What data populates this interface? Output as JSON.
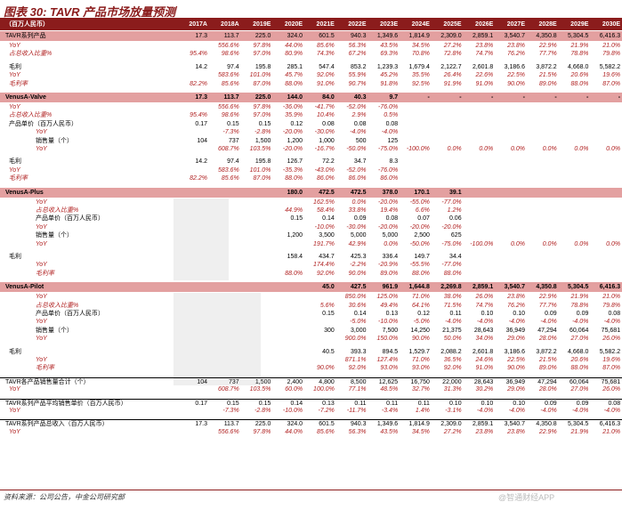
{
  "title": "图表 30: TAVR 产品市场放量预测",
  "years": [
    "2017A",
    "2018A",
    "2019E",
    "2020E",
    "2021E",
    "2022E",
    "2023E",
    "2024E",
    "2025E",
    "2026E",
    "2027E",
    "2028E",
    "2029E",
    "2030E"
  ],
  "header_label": "（百万人民币）",
  "rows": [
    {
      "label": "TAVR系列产品",
      "style": "sec",
      "v": [
        "17.3",
        "113.7",
        "225.0",
        "324.0",
        "601.5",
        "940.3",
        "1,349.6",
        "1,814.9",
        "2,309.0",
        "2,859.1",
        "3,540.7",
        "4,350.8",
        "5,304.5",
        "6,416.3"
      ]
    },
    {
      "label": "YoY",
      "style": "red i1",
      "v": [
        "",
        "556.6%",
        "97.8%",
        "44.0%",
        "85.6%",
        "56.3%",
        "43.5%",
        "34.5%",
        "27.2%",
        "23.8%",
        "23.8%",
        "22.9%",
        "21.9%",
        "21.0%"
      ]
    },
    {
      "label": "占总收入比重%",
      "style": "red i1",
      "v": [
        "95.4%",
        "98.6%",
        "97.0%",
        "80.9%",
        "74.3%",
        "67.2%",
        "69.3%",
        "70.8%",
        "72.8%",
        "74.7%",
        "76.2%",
        "77.7%",
        "78.8%",
        "79.8%"
      ]
    },
    {
      "label": "",
      "style": "gap",
      "v": []
    },
    {
      "label": "毛利",
      "style": "i1",
      "v": [
        "14.2",
        "97.4",
        "195.8",
        "285.1",
        "547.4",
        "853.2",
        "1,239.3",
        "1,679.4",
        "2,122.7",
        "2,601.8",
        "3,186.6",
        "3,872.2",
        "4,668.0",
        "5,582.2"
      ]
    },
    {
      "label": "YoY",
      "style": "red i1",
      "v": [
        "",
        "583.6%",
        "101.0%",
        "45.7%",
        "92.0%",
        "55.9%",
        "45.2%",
        "35.5%",
        "26.4%",
        "22.6%",
        "22.5%",
        "21.5%",
        "20.6%",
        "19.6%"
      ]
    },
    {
      "label": "毛利率",
      "style": "red i1",
      "v": [
        "82.2%",
        "85.6%",
        "87.0%",
        "88.0%",
        "91.0%",
        "90.7%",
        "91.8%",
        "92.5%",
        "91.9%",
        "91.0%",
        "90.0%",
        "89.0%",
        "88.0%",
        "87.0%"
      ]
    },
    {
      "label": "",
      "style": "gap",
      "v": []
    },
    {
      "label": "VenusA-Valve",
      "style": "sec bold",
      "v": [
        "17.3",
        "113.7",
        "225.0",
        "144.0",
        "84.0",
        "40.3",
        "9.7",
        "-",
        "-",
        "-",
        "-",
        "-",
        "-",
        "-"
      ]
    },
    {
      "label": "YoY",
      "style": "red i1",
      "v": [
        "",
        "556.6%",
        "97.8%",
        "-36.0%",
        "-41.7%",
        "-52.0%",
        "-76.0%",
        "",
        "",
        "",
        "",
        "",
        "",
        ""
      ]
    },
    {
      "label": "占总收入比重%",
      "style": "red i1",
      "v": [
        "95.4%",
        "98.6%",
        "97.0%",
        "35.9%",
        "10.4%",
        "2.9%",
        "0.5%",
        "",
        "",
        "",
        "",
        "",
        "",
        ""
      ]
    },
    {
      "label": "产品单价（百万人民币）",
      "style": "i1",
      "v": [
        "0.17",
        "0.15",
        "0.15",
        "0.12",
        "0.08",
        "0.08",
        "0.08",
        "",
        "",
        "",
        "",
        "",
        "",
        ""
      ]
    },
    {
      "label": "YoY",
      "style": "red i2",
      "v": [
        "",
        "-7.3%",
        "-2.8%",
        "-20.0%",
        "-30.0%",
        "-4.0%",
        "-4.0%",
        "",
        "",
        "",
        "",
        "",
        "",
        ""
      ]
    },
    {
      "label": "销售量（个）",
      "style": "i2",
      "v": [
        "104",
        "737",
        "1,500",
        "1,200",
        "1,000",
        "500",
        "125",
        "",
        "",
        "",
        "",
        "",
        "",
        ""
      ]
    },
    {
      "label": "YoY",
      "style": "red i2",
      "v": [
        "",
        "608.7%",
        "103.5%",
        "-20.0%",
        "-16.7%",
        "-50.0%",
        "-75.0%",
        "-100.0%",
        "0.0%",
        "0.0%",
        "0.0%",
        "0.0%",
        "0.0%",
        "0.0%"
      ]
    },
    {
      "label": "",
      "style": "gap",
      "v": []
    },
    {
      "label": "毛利",
      "style": "i1",
      "v": [
        "14.2",
        "97.4",
        "195.8",
        "126.7",
        "72.2",
        "34.7",
        "8.3",
        "",
        "",
        "",
        "",
        "",
        "",
        ""
      ]
    },
    {
      "label": "YoY",
      "style": "red i1",
      "v": [
        "",
        "583.6%",
        "101.0%",
        "-35.3%",
        "-43.0%",
        "-52.0%",
        "-76.0%",
        "",
        "",
        "",
        "",
        "",
        "",
        ""
      ]
    },
    {
      "label": "毛利率",
      "style": "red i1",
      "v": [
        "82.2%",
        "85.6%",
        "87.0%",
        "88.0%",
        "86.0%",
        "86.0%",
        "86.0%",
        "",
        "",
        "",
        "",
        "",
        "",
        ""
      ]
    },
    {
      "label": "",
      "style": "gap",
      "v": []
    },
    {
      "label": "VenusA-Plus",
      "style": "sec bold",
      "v": [
        "",
        "",
        "",
        "180.0",
        "472.5",
        "472.5",
        "378.0",
        "170.1",
        "39.1",
        "",
        "",
        "",
        "",
        ""
      ]
    },
    {
      "label": "YoY",
      "style": "red i2",
      "v": [
        "",
        "",
        "",
        "",
        "162.5%",
        "0.0%",
        "-20.0%",
        "-55.0%",
        "-77.0%",
        "",
        "",
        "",
        "",
        ""
      ]
    },
    {
      "label": "占总收入比重%",
      "style": "red i2",
      "v": [
        "",
        "",
        "",
        "44.9%",
        "58.4%",
        "33.8%",
        "19.4%",
        "6.6%",
        "1.2%",
        "",
        "",
        "",
        "",
        ""
      ]
    },
    {
      "label": "产品单价（百万人民币）",
      "style": "i2",
      "v": [
        "",
        "",
        "",
        "0.15",
        "0.14",
        "0.09",
        "0.08",
        "0.07",
        "0.06",
        "",
        "",
        "",
        "",
        ""
      ]
    },
    {
      "label": "YoY",
      "style": "red i2",
      "v": [
        "",
        "",
        "",
        "",
        "-10.0%",
        "-30.0%",
        "-20.0%",
        "-20.0%",
        "-20.0%",
        "",
        "",
        "",
        "",
        ""
      ]
    },
    {
      "label": "销售量（个）",
      "style": "i2",
      "v": [
        "",
        "",
        "",
        "1,200",
        "3,500",
        "5,000",
        "5,000",
        "2,500",
        "625",
        "",
        "",
        "",
        "",
        ""
      ]
    },
    {
      "label": "YoY",
      "style": "red i2",
      "v": [
        "",
        "",
        "",
        "",
        "191.7%",
        "42.9%",
        "0.0%",
        "-50.0%",
        "-75.0%",
        "-100.0%",
        "0.0%",
        "0.0%",
        "0.0%",
        "0.0%"
      ]
    },
    {
      "label": "",
      "style": "gap",
      "v": []
    },
    {
      "label": "毛利",
      "style": "i1",
      "v": [
        "",
        "",
        "",
        "158.4",
        "434.7",
        "425.3",
        "336.4",
        "149.7",
        "34.4",
        "",
        "",
        "",
        "",
        ""
      ]
    },
    {
      "label": "YoY",
      "style": "red i2",
      "v": [
        "",
        "",
        "",
        "",
        "174.4%",
        "-2.2%",
        "-20.9%",
        "-55.5%",
        "-77.0%",
        "",
        "",
        "",
        "",
        ""
      ]
    },
    {
      "label": "毛利率",
      "style": "red i2",
      "v": [
        "",
        "",
        "",
        "88.0%",
        "92.0%",
        "90.0%",
        "89.0%",
        "88.0%",
        "88.0%",
        "",
        "",
        "",
        "",
        ""
      ]
    },
    {
      "label": "",
      "style": "gap",
      "v": []
    },
    {
      "label": "VenusA-Pilot",
      "style": "sec bold",
      "v": [
        "",
        "",
        "",
        "",
        "45.0",
        "427.5",
        "961.9",
        "1,644.8",
        "2,269.8",
        "2,859.1",
        "3,540.7",
        "4,350.8",
        "5,304.5",
        "6,416.3"
      ]
    },
    {
      "label": "YoY",
      "style": "red i2",
      "v": [
        "",
        "",
        "",
        "",
        "",
        "850.0%",
        "125.0%",
        "71.0%",
        "38.0%",
        "26.0%",
        "23.8%",
        "22.9%",
        "21.9%",
        "21.0%"
      ]
    },
    {
      "label": "占总收入比重%",
      "style": "red i2",
      "v": [
        "",
        "",
        "",
        "",
        "5.6%",
        "30.6%",
        "49.4%",
        "64.1%",
        "71.5%",
        "74.7%",
        "76.2%",
        "77.7%",
        "78.8%",
        "79.8%"
      ]
    },
    {
      "label": "产品单价（百万人民币）",
      "style": "i2",
      "v": [
        "",
        "",
        "",
        "",
        "0.15",
        "0.14",
        "0.13",
        "0.12",
        "0.11",
        "0.10",
        "0.10",
        "0.09",
        "0.09",
        "0.08"
      ]
    },
    {
      "label": "YoY",
      "style": "red i2",
      "v": [
        "",
        "",
        "",
        "",
        "",
        "-5.0%",
        "-10.0%",
        "-5.0%",
        "-4.0%",
        "-4.0%",
        "-4.0%",
        "-4.0%",
        "-4.0%",
        "-4.0%"
      ]
    },
    {
      "label": "销售量（个）",
      "style": "i2",
      "v": [
        "",
        "",
        "",
        "",
        "300",
        "3,000",
        "7,500",
        "14,250",
        "21,375",
        "28,643",
        "36,949",
        "47,294",
        "60,064",
        "75,681"
      ]
    },
    {
      "label": "YoY",
      "style": "red i2",
      "v": [
        "",
        "",
        "",
        "",
        "",
        "900.0%",
        "150.0%",
        "90.0%",
        "50.0%",
        "34.0%",
        "29.0%",
        "28.0%",
        "27.0%",
        "26.0%"
      ]
    },
    {
      "label": "",
      "style": "gap",
      "v": []
    },
    {
      "label": "毛利",
      "style": "i1",
      "v": [
        "",
        "",
        "",
        "",
        "40.5",
        "393.3",
        "894.5",
        "1,529.7",
        "2,088.2",
        "2,601.8",
        "3,186.6",
        "3,872.2",
        "4,668.0",
        "5,582.2"
      ]
    },
    {
      "label": "YoY",
      "style": "red i2",
      "v": [
        "",
        "",
        "",
        "",
        "",
        "871.1%",
        "127.4%",
        "71.0%",
        "36.5%",
        "24.6%",
        "22.5%",
        "21.5%",
        "20.6%",
        "19.6%"
      ]
    },
    {
      "label": "毛利率",
      "style": "red i2",
      "v": [
        "",
        "",
        "",
        "",
        "90.0%",
        "92.0%",
        "93.0%",
        "93.0%",
        "92.0%",
        "91.0%",
        "90.0%",
        "89.0%",
        "88.0%",
        "87.0%"
      ]
    },
    {
      "label": "",
      "style": "gap",
      "v": []
    },
    {
      "label": "TAVR各产品销售量合计（个）",
      "style": "topline",
      "v": [
        "104",
        "737",
        "1,500",
        "2,400",
        "4,800",
        "8,500",
        "12,625",
        "16,750",
        "22,000",
        "28,643",
        "36,949",
        "47,294",
        "60,064",
        "75,681"
      ]
    },
    {
      "label": "YoY",
      "style": "red i1",
      "v": [
        "",
        "608.7%",
        "103.5%",
        "60.0%",
        "100.0%",
        "77.1%",
        "48.5%",
        "32.7%",
        "31.3%",
        "30.2%",
        "29.0%",
        "28.0%",
        "27.0%",
        "26.0%"
      ]
    },
    {
      "label": "",
      "style": "gap",
      "v": []
    },
    {
      "label": "TAVR系列产品平均销售单价（百万人民币）",
      "style": "topline",
      "v": [
        "0.17",
        "0.15",
        "0.15",
        "0.14",
        "0.13",
        "0.11",
        "0.11",
        "0.11",
        "0.10",
        "0.10",
        "0.10",
        "0.09",
        "0.09",
        "0.08"
      ]
    },
    {
      "label": "YoY",
      "style": "red i1",
      "v": [
        "",
        "-7.3%",
        "-2.8%",
        "-10.0%",
        "-7.2%",
        "-11.7%",
        "-3.4%",
        "1.4%",
        "-3.1%",
        "-4.0%",
        "-4.0%",
        "-4.0%",
        "-4.0%",
        "-4.0%"
      ]
    },
    {
      "label": "",
      "style": "gap",
      "v": []
    },
    {
      "label": "TAVR系列产品总收入（百万人民币）",
      "style": "topline",
      "v": [
        "17.3",
        "113.7",
        "225.0",
        "324.0",
        "601.5",
        "940.3",
        "1,349.6",
        "1,814.9",
        "2,309.0",
        "2,859.1",
        "3,540.7",
        "4,350.8",
        "5,304.5",
        "6,416.3"
      ]
    },
    {
      "label": "YoY",
      "style": "red i1",
      "v": [
        "",
        "556.6%",
        "97.8%",
        "44.0%",
        "85.6%",
        "56.3%",
        "43.5%",
        "34.5%",
        "27.2%",
        "23.8%",
        "23.8%",
        "22.9%",
        "21.9%",
        "21.0%"
      ]
    }
  ],
  "source": "资料来源：公司公告，中金公司研究部",
  "watermark": "@智通财经APP"
}
